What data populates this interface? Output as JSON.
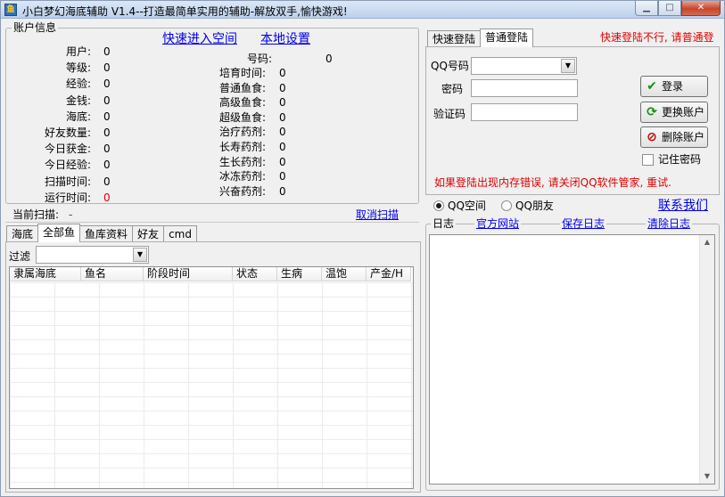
{
  "window": {
    "title": "小白梦幻海底辅助 V1.4--打造最简单实用的辅助-解放双手,愉快游戏!",
    "icon": "app-icon"
  },
  "account": {
    "group_label": "账户信息",
    "quick_enter": "快速进入空间",
    "local_settings": "本地设置",
    "fields_left": [
      {
        "label": "用户:",
        "value": "0"
      },
      {
        "label": "等级:",
        "value": "0"
      },
      {
        "label": "经验:",
        "value": "0"
      },
      {
        "label": "金钱:",
        "value": "0"
      },
      {
        "label": "海底:",
        "value": "0"
      },
      {
        "label": "好友数量:",
        "value": "0"
      },
      {
        "label": "今日获金:",
        "value": "0"
      },
      {
        "label": "今日经验:",
        "value": "0"
      },
      {
        "label": "扫描时间:",
        "value": "0"
      },
      {
        "label": "运行时间:",
        "value": "0"
      }
    ],
    "fields_right": [
      {
        "label": "号码:",
        "value": "0"
      },
      {
        "label": "培育时间:",
        "value": "0"
      },
      {
        "label": "普通鱼食:",
        "value": "0"
      },
      {
        "label": "高级鱼食:",
        "value": "0"
      },
      {
        "label": "超级鱼食:",
        "value": "0"
      },
      {
        "label": "治疗药剂:",
        "value": "0"
      },
      {
        "label": "长寿药剂:",
        "value": "0"
      },
      {
        "label": "生长药剂:",
        "value": "0"
      },
      {
        "label": "冰冻药剂:",
        "value": "0"
      },
      {
        "label": "兴奋药剂:",
        "value": "0"
      }
    ],
    "current_scan_label": "当前扫描:",
    "current_scan_value": "-",
    "cancel_scan": "取消扫描"
  },
  "lower_tabs": [
    {
      "label": "海底",
      "active": false
    },
    {
      "label": "全部鱼",
      "active": true
    },
    {
      "label": "鱼库资料",
      "active": false
    },
    {
      "label": "好友",
      "active": false
    },
    {
      "label": "cmd",
      "active": false
    }
  ],
  "filter": {
    "label": "过滤",
    "value": ""
  },
  "fish_table": {
    "columns": [
      "隶属海底",
      "鱼名",
      "阶段时间",
      "状态",
      "生病",
      "温饱",
      "产金/H"
    ],
    "rows": []
  },
  "login": {
    "tabs": [
      {
        "label": "快速登陆",
        "active": false
      },
      {
        "label": "普通登陆",
        "active": true
      }
    ],
    "notice": "快速登陆不行, 请普通登",
    "qq_label": "QQ号码",
    "qq_value": "",
    "password_label": "密码",
    "captcha_label": "验证码",
    "login_button": "登录",
    "switch_button": "更换账户",
    "delete_button": "删除账户",
    "remember_label": "记住密码",
    "remember_checked": false,
    "warning": "如果登陆出现内存错误, 请关闭QQ软件管家, 重试."
  },
  "mode": {
    "options": [
      {
        "label": "QQ空间",
        "checked": true
      },
      {
        "label": "QQ朋友",
        "checked": false
      }
    ],
    "contact": "联系我们"
  },
  "log": {
    "group_label": "日志",
    "official_site": "官方网站",
    "save_log": "保存日志",
    "clear_log": "清除日志",
    "content": ""
  },
  "colors": {
    "link": "#0000ee",
    "warning_red": "#e00000",
    "green_check": "#1c8c1c"
  }
}
